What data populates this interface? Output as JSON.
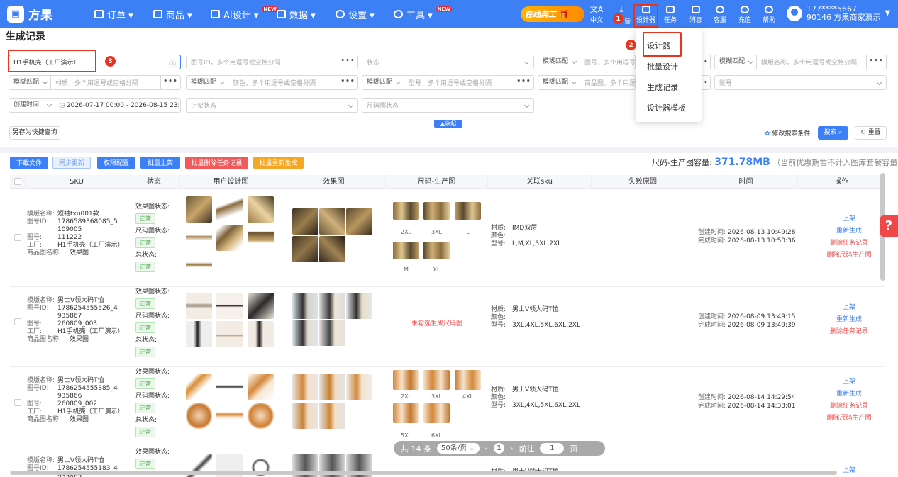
{
  "brand": {
    "name": "方果"
  },
  "nav": [
    {
      "label": "订单 ▾",
      "new": ""
    },
    {
      "label": "商品 ▾",
      "new": ""
    },
    {
      "label": "AI设计 ▾",
      "new": "NEW"
    },
    {
      "label": "数据 ▾",
      "new": ""
    },
    {
      "label": "设置 ▾",
      "new": ""
    },
    {
      "label": "工具 ▾",
      "new": "NEW"
    }
  ],
  "promo": "在线美工",
  "tools": [
    {
      "label": "中文",
      "icon": "translate-icon"
    },
    {
      "label": "",
      "icon": "download-icon",
      "badge": "1"
    },
    {
      "label": "设计器",
      "icon": "designer-icon"
    },
    {
      "label": "任务",
      "icon": "task-icon"
    },
    {
      "label": "消息",
      "icon": "message-icon"
    },
    {
      "label": "客服",
      "icon": "service-icon"
    },
    {
      "label": "充值",
      "icon": "recharge-icon"
    },
    {
      "label": "帮助",
      "icon": "help-icon"
    }
  ],
  "user": {
    "phone": "177****5667",
    "account": "90146 方果商家演示"
  },
  "menu": {
    "items": [
      "设计器",
      "批量设计",
      "生成记录",
      "设计器模板"
    ],
    "badge": "2"
  },
  "page": {
    "title": "生成记录"
  },
  "filters": {
    "factory": "H1手机壳（工厂演示）",
    "factory_badge": "3",
    "pattern_ph": "图号ID，多个用逗号或空格分隔",
    "status_ph": "状态",
    "fuzzy": "模糊匹配",
    "pattern_no_ph": "图号，多个用逗号或空格分隔",
    "template_ph": "模版名称，多个用逗号或空格分隔",
    "material_ph": "材质，多个用逗号或空格分隔",
    "color_ph": "颜色，多个用逗号或空格分隔",
    "model_ph": "型号，多个用逗号或空格分隔",
    "product_img_ph": "商品图，多个用逗号或空格分隔",
    "account_ph": "账号",
    "time_type": "创建时间",
    "date_range": "2026-07-17 00:00 - 2026-08-15 23:59",
    "listing_ph": "上架状态",
    "size_img_ph": "尺码图状态",
    "collapse": "▲收起",
    "save_quick": "另存为快捷查询",
    "modify": "修改搜索条件",
    "search": "搜索",
    "reset": "重置"
  },
  "actions": [
    {
      "label": "下载文件",
      "color": "#3d7ff5"
    },
    {
      "label": "同步更新",
      "color": "#a9c6fa"
    },
    {
      "label": "权限配置",
      "color": "#3d7ff5"
    },
    {
      "label": "批量上架",
      "color": "#3d7ff5"
    },
    {
      "label": "批量删除任务记录",
      "color": "#f05a5a"
    },
    {
      "label": "批量重新生成",
      "color": "#f5a623"
    }
  ],
  "capacity": {
    "label": "尺码-生产图容量:",
    "value": "371.78MB",
    "note": "（当前优惠期暂不计入图库套餐容量）"
  },
  "columns": [
    "SKU",
    "状态",
    "用户设计图",
    "效果图",
    "尺码-生产图",
    "关联sku",
    "失败原因",
    "时间",
    "操作"
  ],
  "labels": {
    "template": "模版名称:",
    "pid": "图号ID:",
    "pno": "图号:",
    "factory": "工厂:",
    "pimg": "商品图名称:",
    "effect_status": "效果图状态:",
    "size_status": "尺码图状态:",
    "total_status": "总状态:",
    "ok": "正常",
    "material": "材质:",
    "color": "颜色:",
    "model": "型号:",
    "created": "创建时间:",
    "finished": "完成时间:"
  },
  "rows": [
    {
      "template": "短袖txu001款",
      "pid": "1786589368085_5109005",
      "pno": "111222",
      "factory": "H1手机壳（工厂演示）",
      "pimg": "效果图",
      "sizes": [
        "2XL",
        "3XL",
        "L",
        "M",
        "XL"
      ],
      "fail": "",
      "material": "IMD双层",
      "color": "",
      "model": "L,M,XL,3XL,2XL",
      "created": "2026-08-13 10:49:28",
      "finished": "2026-08-13 10:50:36",
      "ops": [
        "上架",
        "重新生成",
        "删除任务记录",
        "删除尺码生产图"
      ]
    },
    {
      "template": "男士V领大码T恤",
      "pid": "1786254555526_4935867",
      "pno": "260809_003",
      "factory": "H1手机壳（工厂演示）",
      "pimg": "效果图",
      "sizes": [],
      "fail": "未勾选生成尺码图",
      "material": "男士V领大码T恤",
      "color": "",
      "model": "3XL,4XL,5XL,6XL,2XL",
      "created": "2026-08-09 13:49:15",
      "finished": "2026-08-09 13:49:39",
      "ops": [
        "上架",
        "重新生成",
        "删除任务记录"
      ]
    },
    {
      "template": "男士V领大码T恤",
      "pid": "1786254555385_4935866",
      "pno": "260809_002",
      "factory": "H1手机壳（工厂演示）",
      "pimg": "效果图",
      "sizes": [
        "2XL",
        "3XL",
        "4XL",
        "5XL",
        "6XL"
      ],
      "fail": "",
      "material": "男士V领大码T恤",
      "color": "",
      "model": "3XL,4XL,5XL,6XL,2XL",
      "created": "2026-08-14 14:29:54",
      "finished": "2026-08-14 14:33:01",
      "ops": [
        "上架",
        "重新生成",
        "删除任务记录",
        "删除尺码生产图"
      ]
    },
    {
      "template": "男士V领大码T恤",
      "pid": "1786254555183_4935865",
      "material": "男士V领大码T恤",
      "ops": [
        "上架"
      ]
    }
  ],
  "pager": {
    "total": "共 14 条",
    "size": "50条/页",
    "page": "1",
    "goto": "前往",
    "input": "1",
    "unit": "页",
    "prev": "‹",
    "next": "›"
  },
  "help": "?",
  "colors": {
    "primary": "#3d7ff5",
    "danger": "#f04848",
    "highlight": "#e8331f",
    "success": "#52a852"
  }
}
